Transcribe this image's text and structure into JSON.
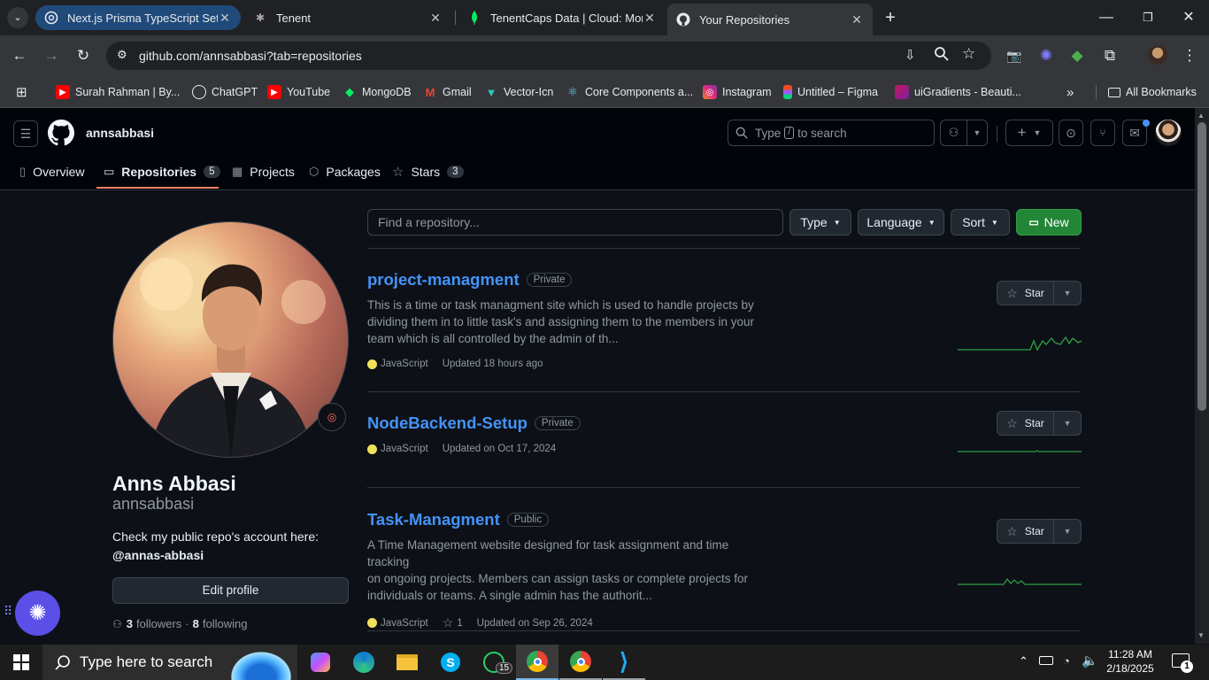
{
  "browser": {
    "tabs": [
      {
        "title": "Next.js Prisma TypeScript Setup",
        "icon": "openai-icon"
      },
      {
        "title": "Tenent",
        "icon": "spider-icon"
      },
      {
        "title": "TenentCaps Data | Cloud: Mong",
        "icon": "mongodb-leaf-icon"
      },
      {
        "title": "Your Repositories",
        "icon": "github-icon"
      }
    ],
    "url": "github.com/annsabbasi?tab=repositories",
    "bookmarks": [
      {
        "label": "Surah Rahman | By...",
        "color": "#ff0000"
      },
      {
        "label": "ChatGPT",
        "color": "#74aa9c"
      },
      {
        "label": "YouTube",
        "color": "#ff0000"
      },
      {
        "label": "MongoDB",
        "color": "#00ed64"
      },
      {
        "label": "Gmail",
        "color": "#ea4335"
      },
      {
        "label": "Vector-Icn",
        "color": "#2ec4b6"
      },
      {
        "label": "Core Components a...",
        "color": "#61dafb"
      },
      {
        "label": "Instagram",
        "color": "#e1306c"
      },
      {
        "label": "Untitled – Figma",
        "color": "#f24e1e"
      },
      {
        "label": "uiGradients - Beauti...",
        "color": "#c2185b"
      }
    ],
    "all_bookmarks": "All Bookmarks"
  },
  "github": {
    "username": "annsabbasi",
    "search_placeholder_pre": "Type",
    "search_key": "/",
    "search_placeholder_post": "to search",
    "nav": [
      {
        "label": "Overview"
      },
      {
        "label": "Repositories",
        "count": "5"
      },
      {
        "label": "Projects"
      },
      {
        "label": "Packages"
      },
      {
        "label": "Stars",
        "count": "3"
      }
    ]
  },
  "profile": {
    "name": "Anns Abbasi",
    "login": "annsabbasi",
    "bio_line1": "Check my public repo's account here:",
    "bio_line2": "@annas-abbasi",
    "edit_label": "Edit profile",
    "followers": "3",
    "followers_label": "followers",
    "following": "8",
    "following_label": "following",
    "separator": "·"
  },
  "filters": {
    "find_placeholder": "Find a repository...",
    "type": "Type",
    "language": "Language",
    "sort": "Sort",
    "new": "New",
    "new_color": "#238636"
  },
  "repos": [
    {
      "name": "project-managment",
      "visibility": "Private",
      "description": [
        "This is a time or task managment site which is used to handle projects by",
        "dividing them in to little task's and assigning them to the members in your",
        "team which is all controlled by the admin of th..."
      ],
      "language": "JavaScript",
      "updated": "Updated 18 hours ago",
      "star_label": "Star"
    },
    {
      "name": "NodeBackend-Setup",
      "visibility": "Private",
      "description": [],
      "language": "JavaScript",
      "updated": "Updated on Oct 17, 2024",
      "star_label": "Star"
    },
    {
      "name": "Task-Managment",
      "visibility": "Public",
      "description": [
        "A Time Management website designed for task assignment and time tracking",
        "on ongoing projects. Members can assign tasks or complete projects for",
        "individuals or teams. A single admin has the authorit..."
      ],
      "language": "JavaScript",
      "stars": "1",
      "updated": "Updated on Sep 26, 2024",
      "star_label": "Star"
    }
  ],
  "taskbar": {
    "search_placeholder": "Type here to search",
    "time": "11:28 AM",
    "date": "2/18/2025",
    "whatsapp_badge": "15",
    "notif_count": "1"
  }
}
